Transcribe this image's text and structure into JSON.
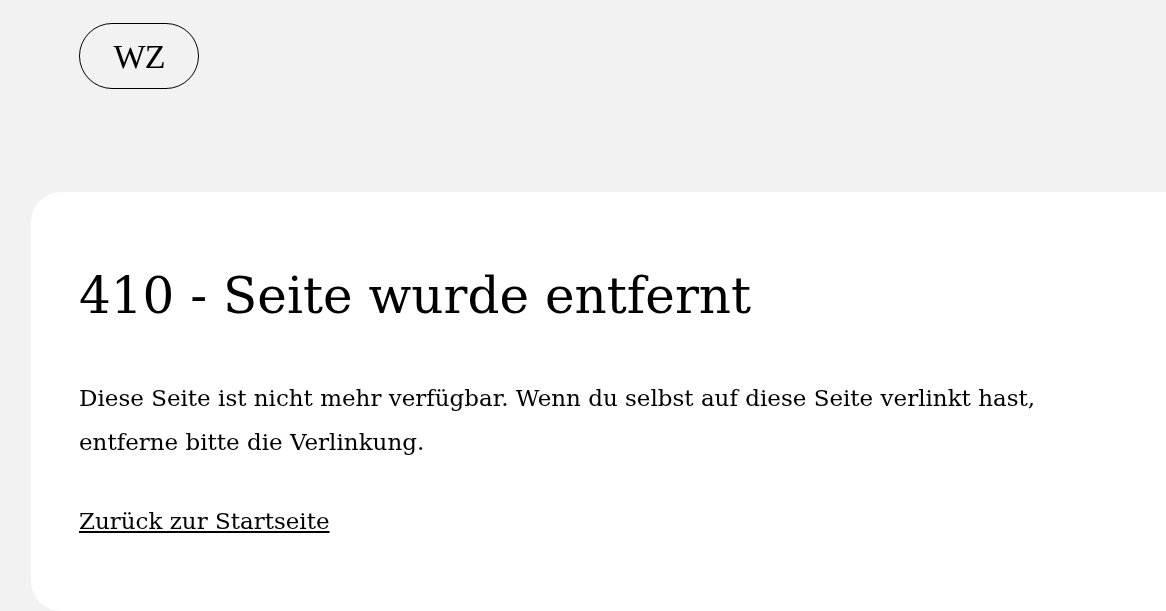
{
  "logo": {
    "text": "WZ"
  },
  "error": {
    "title": "410 - Seite wurde entfernt",
    "message": "Diese Seite ist nicht mehr verfügbar. Wenn du selbst auf diese Seite verlinkt hast, entferne bitte die Verlinkung.",
    "link": "Zurück zur Startseite"
  }
}
